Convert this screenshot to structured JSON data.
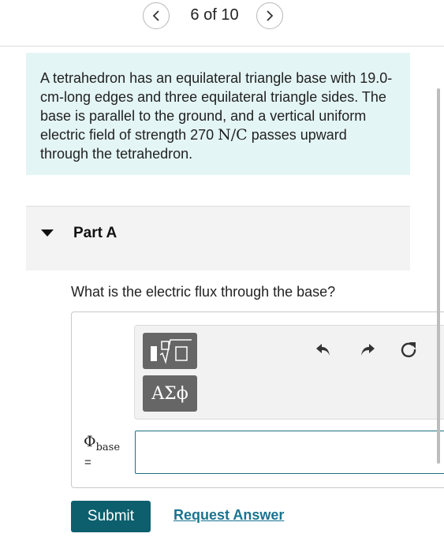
{
  "nav": {
    "counter": "6 of 10",
    "prev_icon": "chevron-left-icon",
    "next_icon": "chevron-right-icon"
  },
  "problem": {
    "text_before_unit": "A tetrahedron has an equilateral triangle base with 19.0-cm-long edges and three equilateral triangle sides. The base is parallel to the ground, and a vertical uniform electric field of strength 270 ",
    "unit": "N/C",
    "text_after_unit": " passes upward through the tetrahedron."
  },
  "part": {
    "title": "Part A",
    "question": "What is the electric flux through the base?"
  },
  "toolbar": {
    "templates_icon": "math-templates-icon",
    "greek_label": "ΑΣϕ",
    "undo_icon": "undo-icon",
    "redo_icon": "redo-icon",
    "reset_icon": "reset-icon"
  },
  "answer": {
    "label_symbol": "Φ",
    "label_subscript": "base",
    "equals": "=",
    "value": ""
  },
  "actions": {
    "submit_label": "Submit",
    "request_answer_label": "Request Answer"
  },
  "colors": {
    "problem_background": "#e4f5f5",
    "submit_background": "#0d5f6e",
    "link": "#1a7390",
    "input_border": "#1e6f80"
  }
}
